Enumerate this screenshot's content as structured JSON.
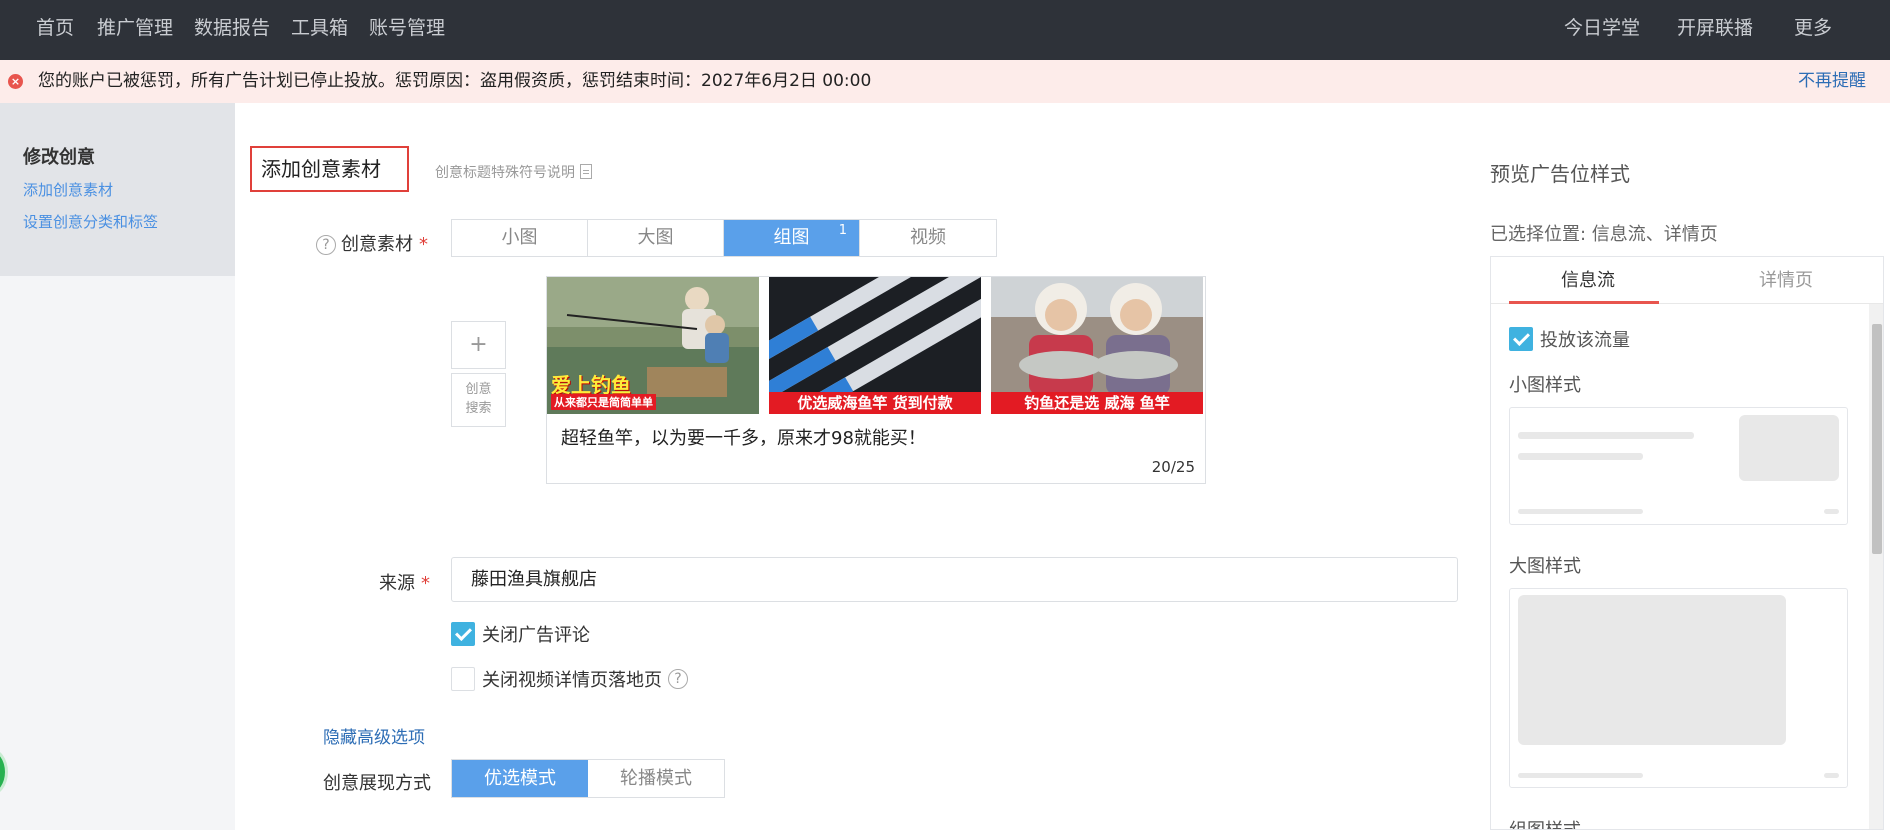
{
  "nav": {
    "left": [
      "首页",
      "推广管理",
      "数据报告",
      "工具箱",
      "账号管理"
    ],
    "right": [
      "今日学堂",
      "开屏联播",
      "更多"
    ]
  },
  "alert": {
    "icon": "error-x-icon",
    "text": "您的账户已被惩罚，所有广告计划已停止投放。惩罚原因：盗用假资质，惩罚结束时间：2027年6月2日 00:00",
    "dismiss": "不再提醒"
  },
  "sidebar": {
    "title": "修改创意",
    "links": [
      "添加创意素材",
      "设置创意分类和标签"
    ]
  },
  "form": {
    "section_title": "添加创意素材",
    "section_hint": "创意标题特殊符号说明",
    "material_label": "创意素材",
    "material_tabs": [
      "小图",
      "大图",
      "组图",
      "视频"
    ],
    "active_tab": "组图",
    "active_tab_badge": "1",
    "add_label": "+",
    "search_label_1": "创意",
    "search_label_2": "搜索",
    "creative": {
      "captions": [
        "爱上钓鱼",
        "优选威海鱼竿  货到付款",
        "钓鱼还是选 威海 鱼竿"
      ],
      "caption_small_1": "从来都只是简简单单",
      "title": "超轻鱼竿，以为要一千多，原来才98就能买！",
      "count": "20/25"
    },
    "source_label": "来源",
    "source_value": "藤田渔具旗舰店",
    "checkbox_close_comment": "关闭广告评论",
    "checkbox_close_video_page": "关闭视频详情页落地页",
    "advanced_link": "隐藏高级选项",
    "display_mode_label": "创意展现方式",
    "display_modes": [
      "优选模式",
      "轮播模式"
    ]
  },
  "preview": {
    "title": "预览广告位样式",
    "selected": "已选择位置: 信息流、详情页",
    "tabs": [
      "信息流",
      "详情页"
    ],
    "checkbox_label": "投放该流量",
    "styles": [
      "小图样式",
      "大图样式",
      "组图样式"
    ]
  },
  "colors": {
    "nav_bg": "#2e3239",
    "accent_blue": "#5aa0ea",
    "alert_red": "#e8554e",
    "check_blue": "#3fb2e0"
  }
}
